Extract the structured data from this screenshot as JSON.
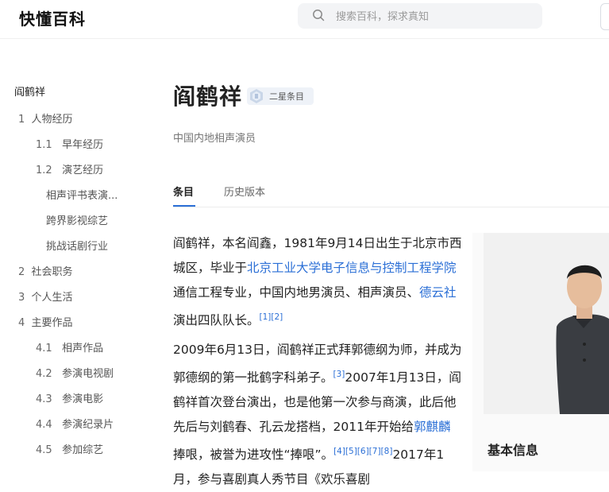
{
  "header": {
    "logo": "快懂百科",
    "search_placeholder": "搜索百科，探求真知"
  },
  "toc": {
    "title": "阎鹤祥",
    "items": [
      {
        "num": "1",
        "label": "人物经历"
      },
      {
        "num": "1.1",
        "label": "早年经历"
      },
      {
        "num": "1.2",
        "label": "演艺经历"
      },
      {
        "num": "",
        "label": "相声评书表演..."
      },
      {
        "num": "",
        "label": "跨界影视综艺"
      },
      {
        "num": "",
        "label": "挑战话剧行业"
      },
      {
        "num": "2",
        "label": "社会职务"
      },
      {
        "num": "3",
        "label": "个人生活"
      },
      {
        "num": "4",
        "label": "主要作品"
      },
      {
        "num": "4.1",
        "label": "相声作品"
      },
      {
        "num": "4.2",
        "label": "参演电视剧"
      },
      {
        "num": "4.3",
        "label": "参演电影"
      },
      {
        "num": "4.4",
        "label": "参演纪录片"
      },
      {
        "num": "4.5",
        "label": "参加综艺"
      }
    ]
  },
  "main": {
    "title": "阎鹤祥",
    "badge": "二星条目",
    "subtitle": "中国内地相声演员",
    "tabs": [
      {
        "label": "条目"
      },
      {
        "label": "历史版本"
      }
    ],
    "p1": {
      "t1": "阎鹤祥，本名阎鑫，1981年9月14日出生于北京市西城区，毕业于",
      "link1": "北京工业大学电子信息与控制工程学院",
      "t2": "通信工程专业，中国内地男演员、相声演员、",
      "link2": "德云社",
      "t3": "演出四队队长。",
      "ref1": "[1][2]"
    },
    "p2": {
      "t1": "2009年6月13日，阎鹤祥正式拜郭德纲为师，并成为郭德纲的第一批鹤字科弟子。",
      "ref1": "[3]",
      "t2": "2007年1月13日，阎鹤祥首次登台演出，也是他第一次参与商演，此后他先后与刘鹤春、孔云龙搭档，2011年开始给",
      "link1": "郭麒麟",
      "t3": "捧哏，被誉为进攻性“捧哏”。",
      "ref2": "[4][5][6][7][8]",
      "t4": "2017年1月，参与喜剧真人秀节目《欢乐喜剧"
    }
  },
  "infobox": {
    "title": "基本信息"
  }
}
